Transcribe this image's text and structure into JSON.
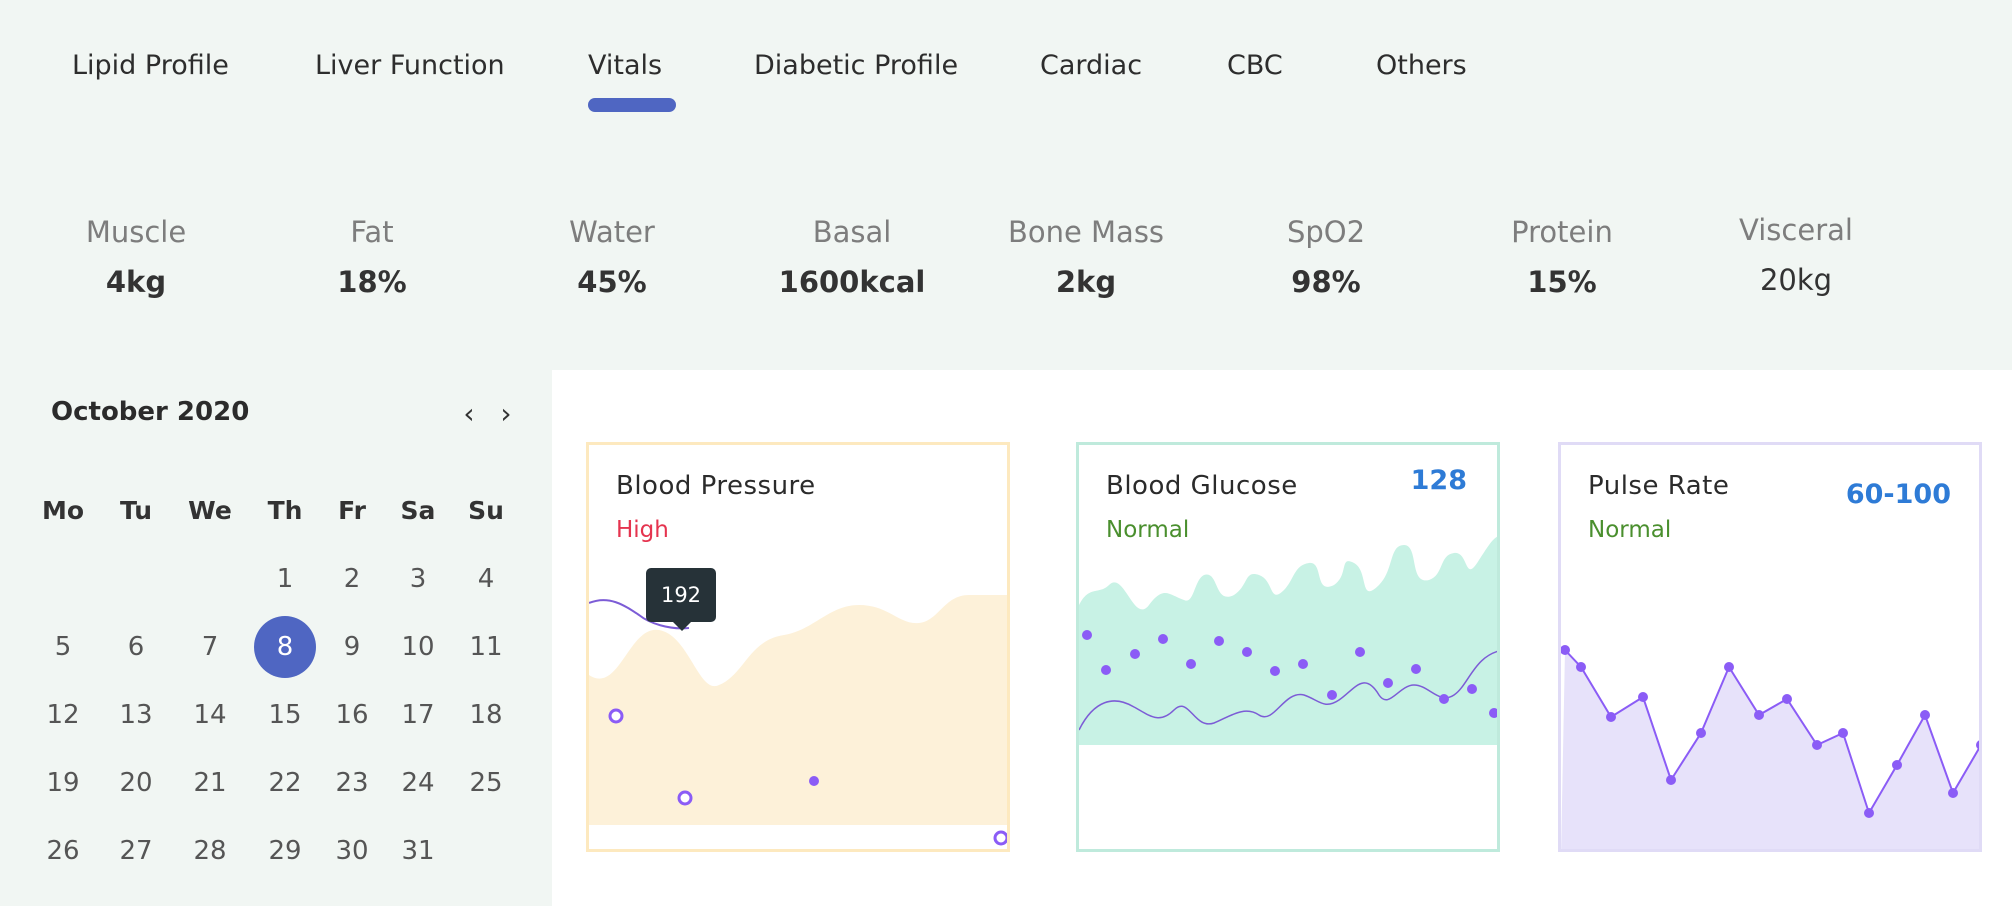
{
  "tabs": [
    {
      "label": "Lipid Profile"
    },
    {
      "label": "Liver Function"
    },
    {
      "label": "Vitals"
    },
    {
      "label": "Diabetic Profile"
    },
    {
      "label": "Cardiac"
    },
    {
      "label": "CBC"
    },
    {
      "label": "Others"
    }
  ],
  "active_tab": "Vitals",
  "metrics": [
    {
      "label": "Muscle",
      "value": "4kg"
    },
    {
      "label": "Fat",
      "value": "18%"
    },
    {
      "label": "Water",
      "value": "45%"
    },
    {
      "label": "Basal",
      "value": "1600kcal"
    },
    {
      "label": "Bone Mass",
      "value": "2kg"
    },
    {
      "label": "SpO2",
      "value": "98%"
    },
    {
      "label": "Protein",
      "value": "15%"
    },
    {
      "label": "Visceral",
      "value": "20kg"
    }
  ],
  "calendar": {
    "title": "October 2020",
    "prev_icon": "chevron-left-icon",
    "next_icon": "chevron-right-icon",
    "prev_glyph": "‹",
    "next_glyph": "›",
    "weekdays": [
      "Mo",
      "Tu",
      "We",
      "Th",
      "Fr",
      "Sa",
      "Su"
    ],
    "days": [
      "1",
      "2",
      "3",
      "4",
      "5",
      "6",
      "7",
      "8",
      "9",
      "10",
      "11",
      "12",
      "13",
      "14",
      "15",
      "16",
      "17",
      "18",
      "19",
      "20",
      "21",
      "22",
      "23",
      "24",
      "25",
      "26",
      "27",
      "28",
      "29",
      "30",
      "31"
    ],
    "selected_day": "8",
    "accent": "#4f66c2"
  },
  "cards": {
    "blood_pressure": {
      "title": "Blood Pressure",
      "status": "High",
      "status_color": "#e5344f",
      "tooltip": "192",
      "border_color": "#fde9bf",
      "fill_color": "#fdf1d9"
    },
    "blood_glucose": {
      "title": "Blood Glucose",
      "status": "Normal",
      "status_color": "#4a8f2e",
      "value": "128",
      "border_color": "#bfeadc",
      "fill_color": "#c8f2e5"
    },
    "pulse_rate": {
      "title": "Pulse Rate",
      "status": "Normal",
      "status_color": "#4a8f2e",
      "value": "60-100",
      "border_color": "#e0dbf6",
      "fill_color": "#e7e2fa",
      "line_color": "#8b5cf6"
    }
  }
}
